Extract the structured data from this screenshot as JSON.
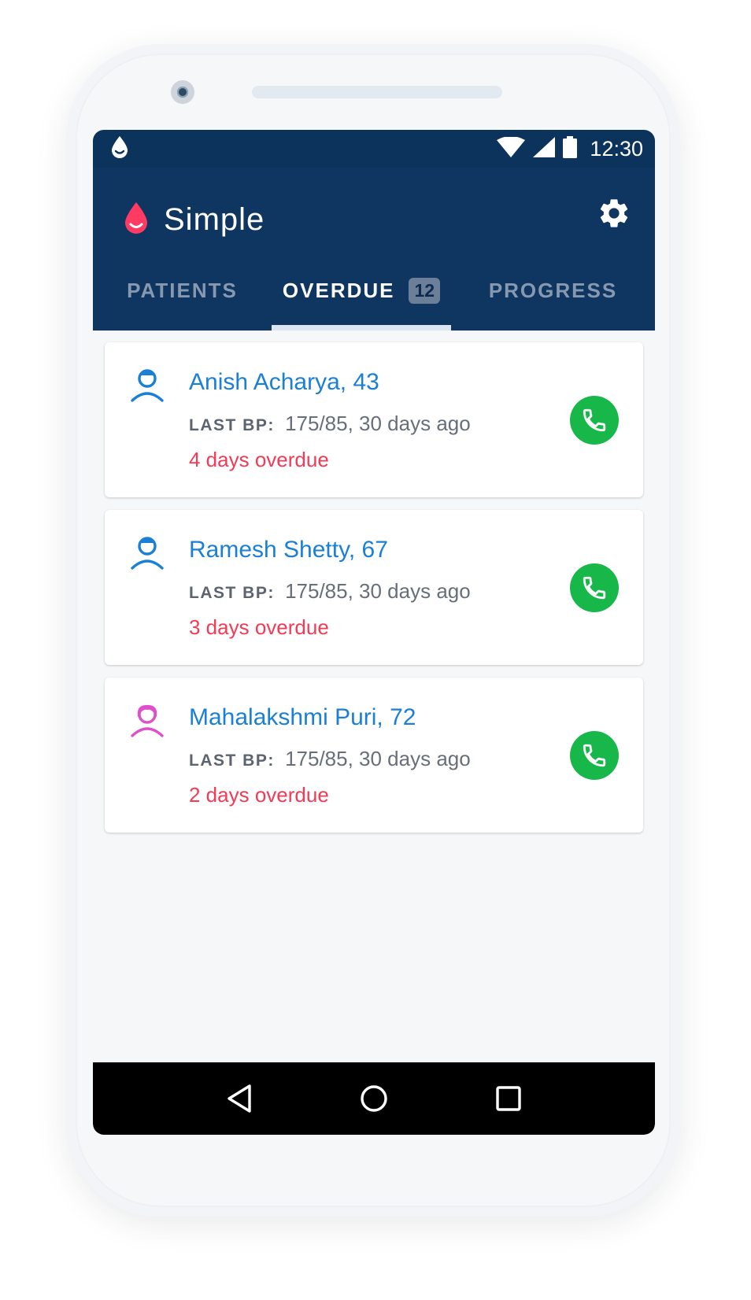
{
  "status_bar": {
    "time": "12:30"
  },
  "app": {
    "title": "Simple"
  },
  "tabs": [
    {
      "label": "PATIENTS",
      "active": false
    },
    {
      "label": "OVERDUE",
      "badge": "12",
      "active": true
    },
    {
      "label": "PROGRESS",
      "active": false
    }
  ],
  "patients": [
    {
      "name": "Anish Acharya, 43",
      "bp_label": "LAST BP:",
      "bp_value": "175/85, 30 days ago",
      "overdue": "4 days overdue",
      "gender": "male"
    },
    {
      "name": "Ramesh Shetty, 67",
      "bp_label": "LAST BP:",
      "bp_value": "175/85, 30 days ago",
      "overdue": "3 days overdue",
      "gender": "male"
    },
    {
      "name": "Mahalakshmi Puri, 72",
      "bp_label": "LAST BP:",
      "bp_value": "175/85, 30 days ago",
      "overdue": "2 days overdue",
      "gender": "female"
    }
  ],
  "colors": {
    "appbar": "#0f3661",
    "name": "#1a7fd6",
    "overdue": "#f43a55",
    "call": "#17b74a",
    "female_icon": "#e04fc9",
    "male_icon": "#1a7fd6"
  },
  "icons": {
    "status": [
      "drop-icon",
      "wifi-icon",
      "signal-icon",
      "battery-icon"
    ],
    "app": [
      "simple-logo-icon",
      "settings-gear-icon"
    ],
    "nav": [
      "back-icon",
      "home-icon",
      "recents-icon"
    ]
  }
}
